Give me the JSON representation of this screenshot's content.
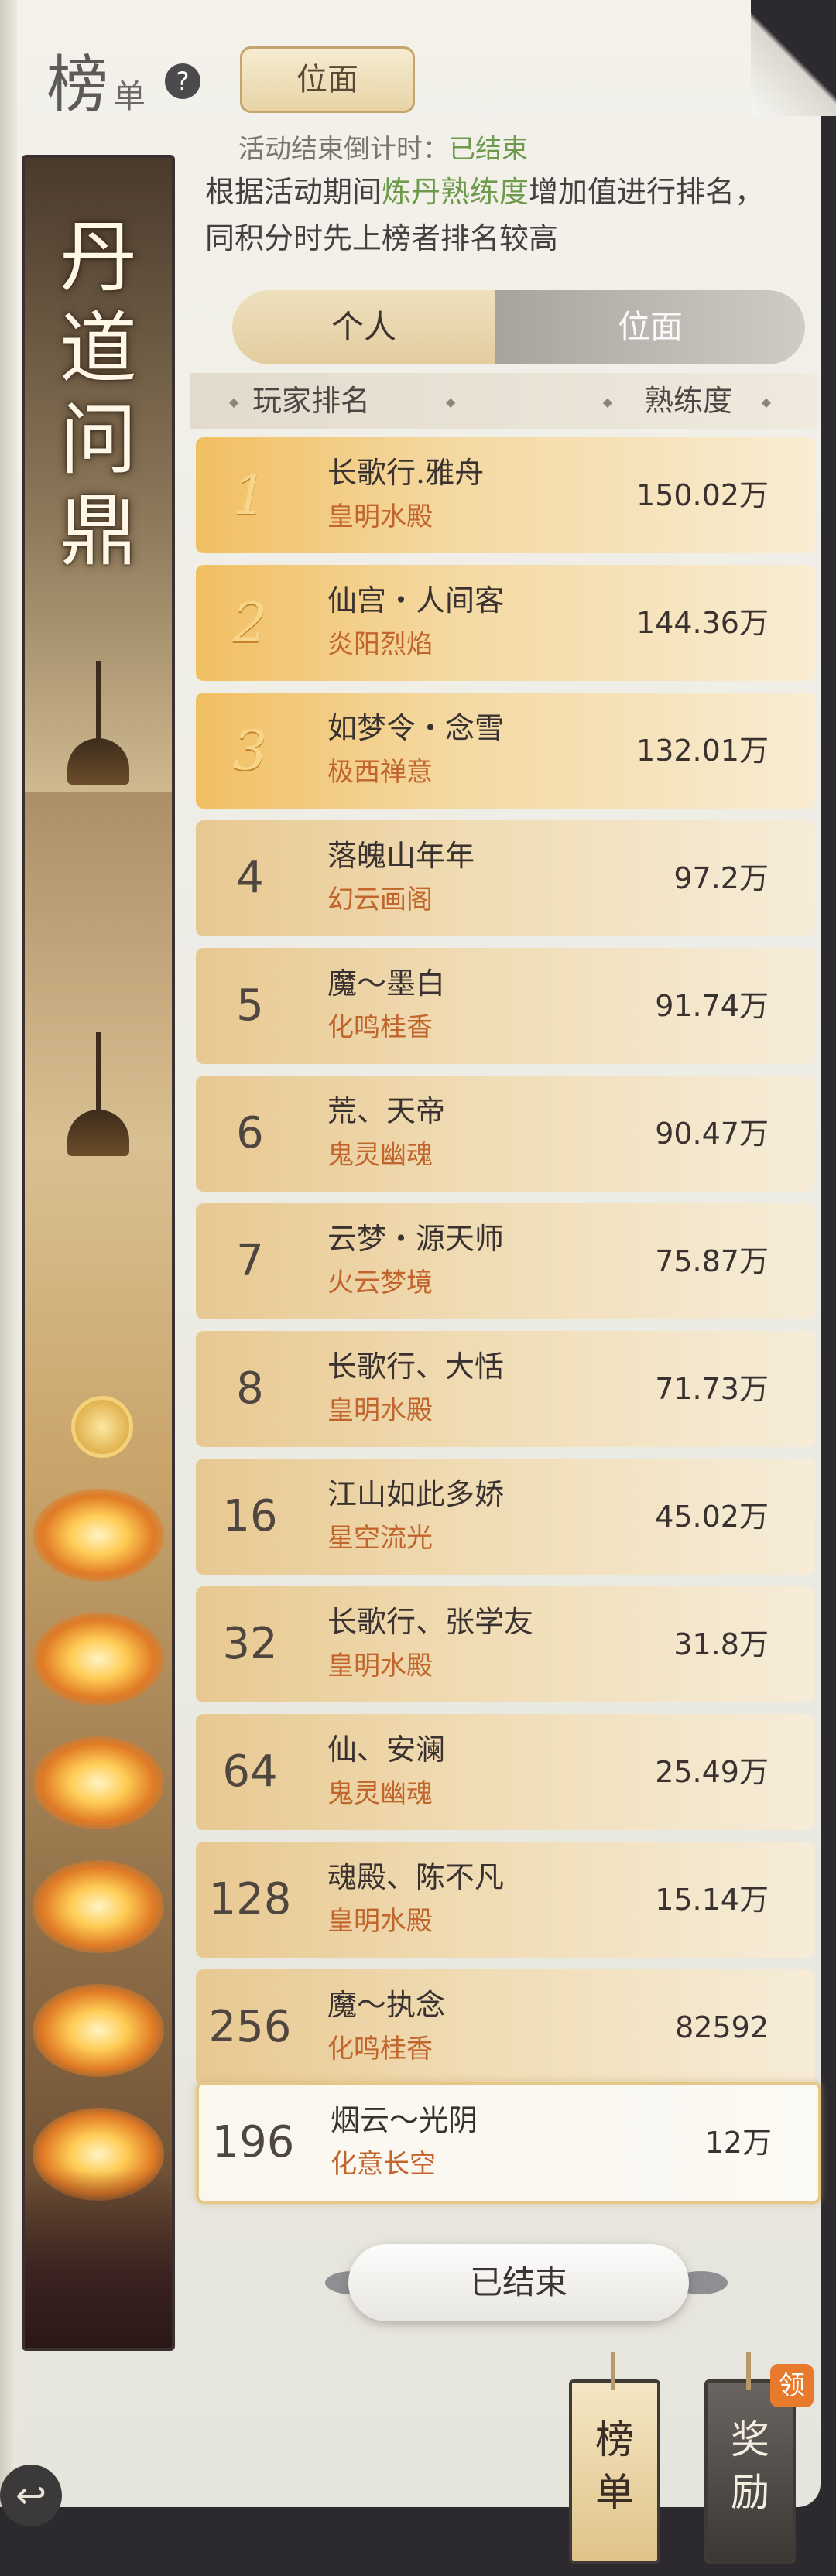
{
  "header": {
    "title_main": "榜",
    "title_sub": "单",
    "help_icon": "?",
    "scope_button": "位面"
  },
  "countdown": {
    "label": "活动结束倒计时：",
    "status": "已结束"
  },
  "description": {
    "part1": "根据活动期间",
    "highlight": "炼丹熟练度",
    "part2": "增加值进行排名，同积分时先上榜者排名较高"
  },
  "banner": {
    "chars": [
      "丹",
      "道",
      "问",
      "鼎"
    ]
  },
  "tabs": {
    "personal": "个人",
    "plane": "位面"
  },
  "table_header": {
    "left": "玩家排名",
    "right": "熟练度",
    "diamond": "◆"
  },
  "rows": [
    {
      "rank": "1",
      "name": "长歌行.雅舟",
      "guild": "皇明水殿",
      "score_num": "150.02",
      "score_unit": "万"
    },
    {
      "rank": "2",
      "name": "仙宫・人间客",
      "guild": "炎阳烈焰",
      "score_num": "144.36",
      "score_unit": "万"
    },
    {
      "rank": "3",
      "name": "如梦令・念雪",
      "guild": "极西禅意",
      "score_num": "132.01",
      "score_unit": "万"
    },
    {
      "rank": "4",
      "name": "落魄山年年",
      "guild": "幻云画阁",
      "score_num": "97.2",
      "score_unit": "万"
    },
    {
      "rank": "5",
      "name": "魔～墨白",
      "guild": "化鸣桂香",
      "score_num": "91.74",
      "score_unit": "万"
    },
    {
      "rank": "6",
      "name": "荒、天帝",
      "guild": "鬼灵幽魂",
      "score_num": "90.47",
      "score_unit": "万"
    },
    {
      "rank": "7",
      "name": "云梦・源天师",
      "guild": "火云梦境",
      "score_num": "75.87",
      "score_unit": "万"
    },
    {
      "rank": "8",
      "name": "长歌行、大恬",
      "guild": "皇明水殿",
      "score_num": "71.73",
      "score_unit": "万"
    },
    {
      "rank": "16",
      "name": "江山如此多娇",
      "guild": "星空流光",
      "score_num": "45.02",
      "score_unit": "万"
    },
    {
      "rank": "32",
      "name": "长歌行、张学友",
      "guild": "皇明水殿",
      "score_num": "31.8",
      "score_unit": "万"
    },
    {
      "rank": "64",
      "name": "仙、安澜",
      "guild": "鬼灵幽魂",
      "score_num": "25.49",
      "score_unit": "万"
    },
    {
      "rank": "128",
      "name": "魂殿、陈不凡",
      "guild": "皇明水殿",
      "score_num": "15.14",
      "score_unit": "万"
    },
    {
      "rank": "256",
      "name": "魔～执念",
      "guild": "化鸣桂香",
      "score_num": "82592",
      "score_unit": ""
    }
  ],
  "self_row": {
    "rank": "196",
    "name": "烟云～光阴",
    "guild": "化意长空",
    "score_num": "12",
    "score_unit": "万"
  },
  "footer": {
    "end_button": "已结束"
  },
  "bottom_tags": {
    "rank_tab": [
      "榜",
      "单"
    ],
    "reward_tab": [
      "奖",
      "励"
    ],
    "claim_badge": "领"
  },
  "back_icon": "↩"
}
